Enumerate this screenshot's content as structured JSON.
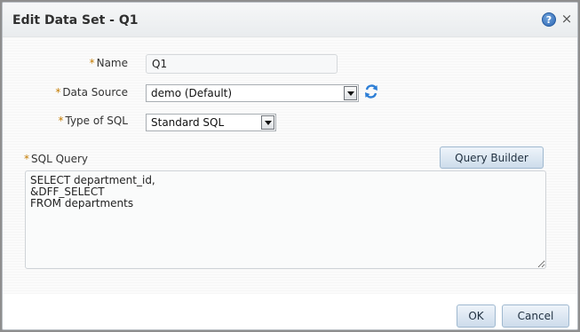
{
  "dialog": {
    "title": "Edit Data Set - Q1",
    "help_icon": "help-question-icon",
    "close_label": "×"
  },
  "form": {
    "required_mark": "*",
    "name": {
      "label": "Name",
      "value": "Q1"
    },
    "data_source": {
      "label": "Data Source",
      "selected": "demo (Default)",
      "refresh_icon": "refresh-icon"
    },
    "sql_type": {
      "label": "Type of SQL",
      "selected": "Standard SQL"
    },
    "sql_query": {
      "label": "SQL Query",
      "value": "SELECT department_id,\n&DFF_SELECT\nFROM departments"
    },
    "query_builder_label": "Query Builder"
  },
  "footer": {
    "ok_label": "OK",
    "cancel_label": "Cancel"
  },
  "colors": {
    "required": "#c47b00",
    "button_bg": "#cddceb",
    "help_icon": "#2f67b3"
  }
}
